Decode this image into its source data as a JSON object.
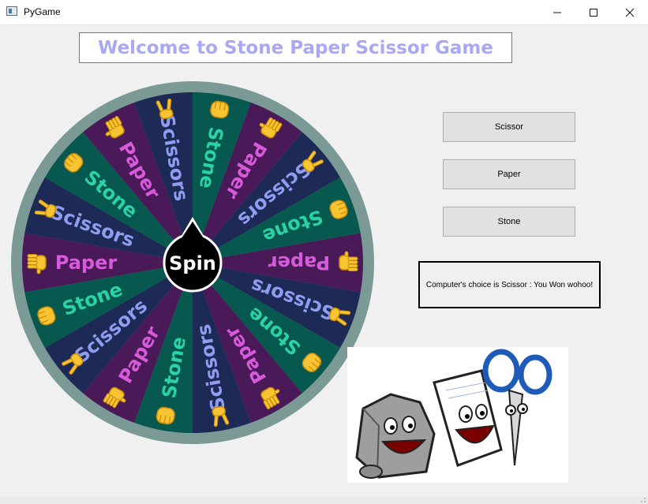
{
  "window": {
    "title": "PyGame",
    "icon": "app-window-icon",
    "controls": [
      "minimize-icon",
      "maximize-icon",
      "close-icon"
    ]
  },
  "heading": "Welcome to Stone Paper Scissor Game",
  "wheel": {
    "center_label": "Spin",
    "segment_labels": [
      "Paper",
      "Scissors",
      "Stone",
      "Paper",
      "Scissors",
      "Stone",
      "Paper",
      "Scissors",
      "Stone",
      "Paper",
      "Scissors",
      "Stone",
      "Paper",
      "Scissors",
      "Stone",
      "Paper",
      "Scissors",
      "Stone"
    ],
    "hand_icons": [
      "open-hand-icon",
      "victory-hand-icon",
      "fist-icon"
    ],
    "colors": {
      "rim": "#7c9a95",
      "Stone": "#07594f",
      "Paper": "#4a1a58",
      "Scissors": "#1d2a55",
      "stone_text": "#2ad2a6",
      "paper_text": "#d65ad9",
      "scissors_text": "#8f9cf0",
      "center": "#000000"
    }
  },
  "buttons": {
    "scissor": "Scissor",
    "paper": "Paper",
    "stone": "Stone"
  },
  "result": "Computer's choice is Scissor : You Won wohoo!",
  "colors": {
    "background": "#f0f0f0",
    "heading_text": "#a9a8f5",
    "button_face": "#e1e1e1",
    "button_border": "#adadad"
  }
}
